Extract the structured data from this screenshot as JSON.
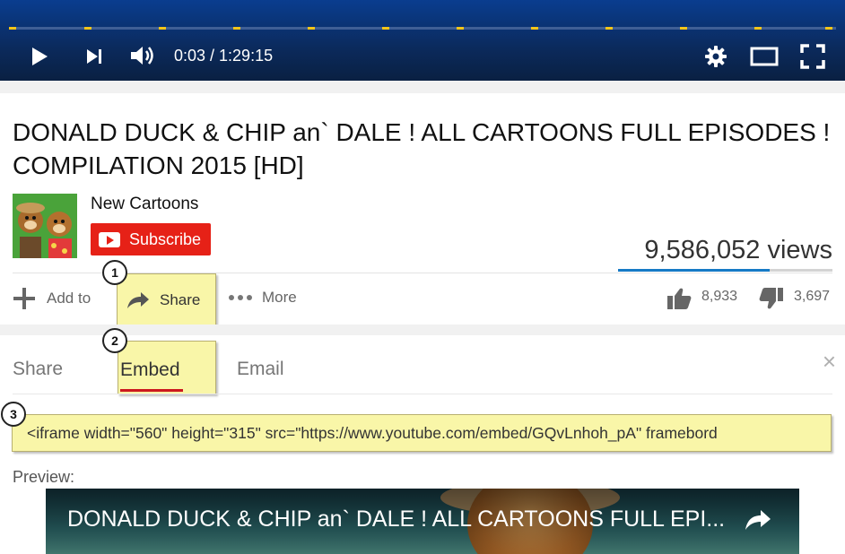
{
  "player": {
    "time_display": "0:03 / 1:29:15",
    "progress_fraction": 0.0006
  },
  "video": {
    "title": "DONALD DUCK & CHIP an` DALE ! ALL CARTOONS FULL EPISODES ! COMPILATION 2015 [HD]",
    "channel_name": "New Cartoons",
    "subscribe_label": "Subscribe",
    "views": "9,586,052 views",
    "like_fraction": 0.708
  },
  "actions": {
    "add_to_label": "Add to",
    "share_label": "Share",
    "more_label": "More",
    "likes": "8,933",
    "dislikes": "3,697"
  },
  "share_panel": {
    "tabs": [
      {
        "label": "Share",
        "active": false
      },
      {
        "label": "Embed",
        "active": true
      },
      {
        "label": "Email",
        "active": false
      }
    ],
    "close_label": "×",
    "embed_code": "<iframe width=\"560\" height=\"315\" src=\"https://www.youtube.com/embed/GQvLnhoh_pA\" framebord",
    "preview_label": "Preview:",
    "preview_title": "DONALD DUCK & CHIP an` DALE ! ALL CARTOONS FULL EPI..."
  },
  "callouts": [
    "1",
    "2",
    "3"
  ],
  "colors": {
    "player_bg": "#0b2a5c",
    "marker": "#f5c518",
    "subscribe_red": "#e62117",
    "highlight": "#f9f6a8",
    "views_blue": "#167ac6"
  }
}
